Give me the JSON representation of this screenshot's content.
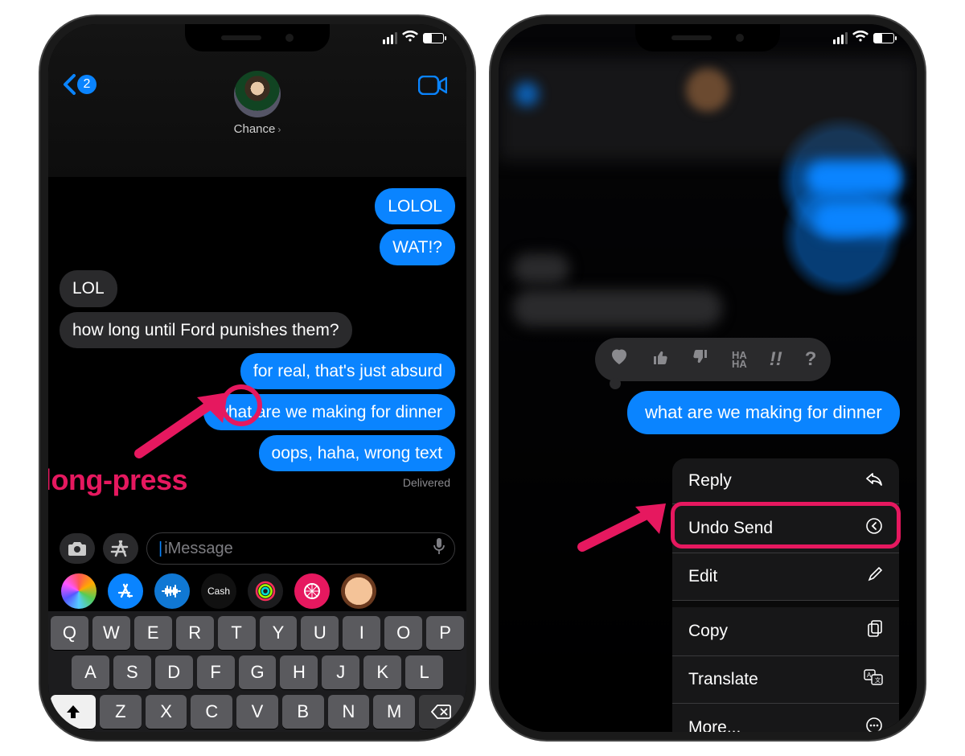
{
  "status": {
    "time_hidden": true
  },
  "phone1": {
    "header": {
      "back_count": "2",
      "contact": "Chance"
    },
    "messages": {
      "out1": "LOLOL",
      "out2": "WAT!?",
      "in1": "LOL",
      "in2": "how long until Ford punishes them?",
      "out3": "for real, that's just absurd",
      "out4": "what are we making for dinner",
      "out5": "oops, haha, wrong text",
      "delivered": "Delivered"
    },
    "input": {
      "placeholder": "iMessage"
    },
    "apps": {
      "cash": "Cash"
    },
    "keyboard": {
      "row1": [
        "Q",
        "W",
        "E",
        "R",
        "T",
        "Y",
        "U",
        "I",
        "O",
        "P"
      ],
      "row2": [
        "A",
        "S",
        "D",
        "F",
        "G",
        "H",
        "J",
        "K",
        "L"
      ],
      "row3": [
        "Z",
        "X",
        "C",
        "V",
        "B",
        "N",
        "M"
      ]
    },
    "annotation": {
      "label": "long-press"
    }
  },
  "phone2": {
    "focus_message": "what are we making for dinner",
    "tapback": {
      "haha": "HA\nHA",
      "bang": "!!",
      "q": "?"
    },
    "menu": {
      "reply": "Reply",
      "undo": "Undo Send",
      "edit": "Edit",
      "copy": "Copy",
      "translate": "Translate",
      "more": "More..."
    }
  }
}
